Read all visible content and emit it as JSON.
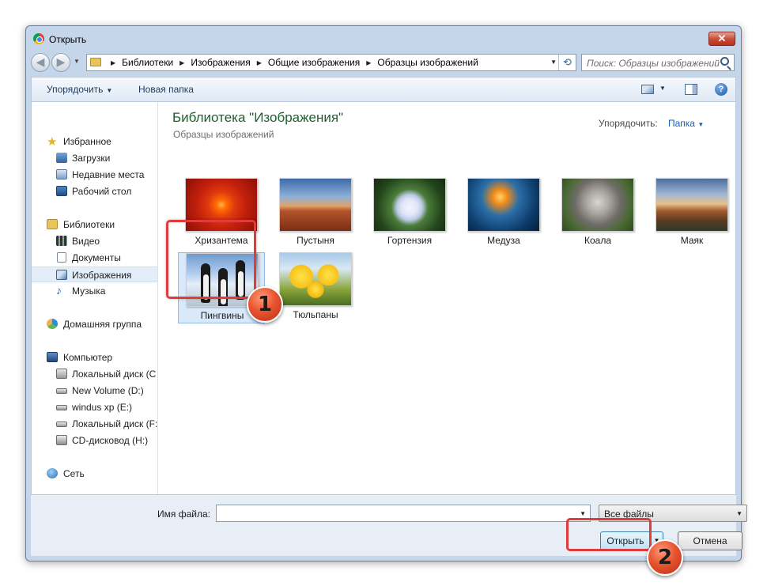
{
  "window": {
    "title": "Открыть",
    "close_glyph": "✕"
  },
  "address": {
    "crumbs": [
      "Библиотеки",
      "Изображения",
      "Общие изображения",
      "Образцы изображений"
    ],
    "search_placeholder": "Поиск: Образцы изображений"
  },
  "toolbar": {
    "organize": "Упорядочить",
    "new_folder": "Новая папка",
    "help_glyph": "?"
  },
  "sidebar": {
    "items": [
      {
        "label": "Избранное",
        "icon": "star-icon"
      },
      {
        "label": "Загрузки",
        "icon": "downloads-icon"
      },
      {
        "label": "Недавние места",
        "icon": "recent-places-icon"
      },
      {
        "label": "Рабочий стол",
        "icon": "desktop-icon"
      },
      {
        "label": "Библиотеки",
        "icon": "libraries-icon"
      },
      {
        "label": "Видео",
        "icon": "video-icon"
      },
      {
        "label": "Документы",
        "icon": "documents-icon"
      },
      {
        "label": "Изображения",
        "icon": "pictures-icon"
      },
      {
        "label": "Музыка",
        "icon": "music-icon"
      },
      {
        "label": "Домашняя группа",
        "icon": "homegroup-icon"
      },
      {
        "label": "Компьютер",
        "icon": "computer-icon"
      },
      {
        "label": "Локальный диск (C",
        "icon": "local-disk-icon"
      },
      {
        "label": "New Volume (D:)",
        "icon": "drive-icon"
      },
      {
        "label": "windus xp (E:)",
        "icon": "drive-icon"
      },
      {
        "label": "Локальный диск (F:",
        "icon": "drive-icon"
      },
      {
        "label": "CD-дисковод (H:)",
        "icon": "cd-drive-icon"
      },
      {
        "label": "Сеть",
        "icon": "network-icon"
      }
    ],
    "selected": "Изображения"
  },
  "main": {
    "library_title": "Библиотека \"Изображения\"",
    "library_subtitle": "Образцы изображений",
    "arrange_label": "Упорядочить:",
    "arrange_value": "Папка",
    "files": [
      {
        "label": "Хризантема"
      },
      {
        "label": "Пустыня"
      },
      {
        "label": "Гортензия"
      },
      {
        "label": "Медуза"
      },
      {
        "label": "Коала"
      },
      {
        "label": "Маяк"
      },
      {
        "label": "Пингвины"
      },
      {
        "label": "Тюльпаны"
      }
    ]
  },
  "footer": {
    "filename_label": "Имя файла:",
    "filename_value": "",
    "filter_value": "Все файлы",
    "open_button": "Открыть",
    "cancel_button": "Отмена"
  },
  "markers": {
    "step1": "1",
    "step2": "2"
  },
  "colors": {
    "highlight": "#e03a3a",
    "marker": "#e8542f",
    "library_title": "#1e5f30"
  }
}
